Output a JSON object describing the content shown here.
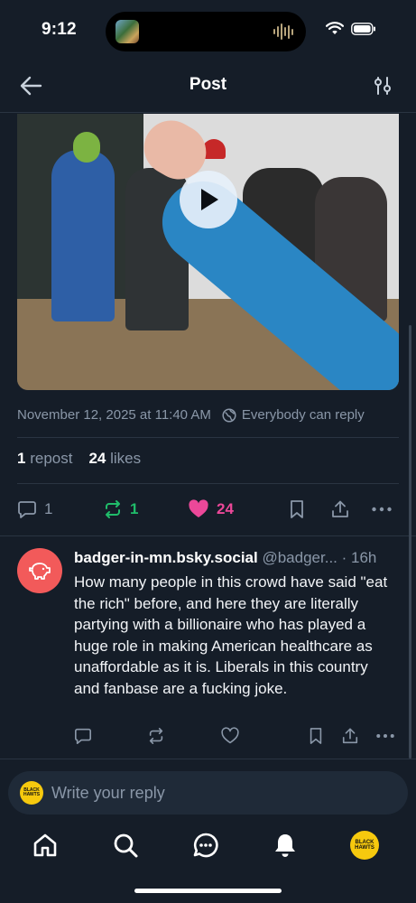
{
  "status": {
    "time": "9:12"
  },
  "header": {
    "title": "Post"
  },
  "post": {
    "date": "November 12, 2025 at 11:40 AM",
    "reply_setting": "Everybody can reply",
    "stats": {
      "reposts_count": "1",
      "reposts_label": "repost",
      "likes_count": "24",
      "likes_label": "likes"
    },
    "actions": {
      "reply_count": "1",
      "repost_count": "1",
      "like_count": "24"
    }
  },
  "reply": {
    "display_name": "badger-in-mn.bsky.social",
    "handle": "@badger...",
    "time": "· 16h",
    "text": "How many people in this crowd have said \"eat the rich\" before, and here they are literally partying with a billionaire who has played a huge role in making American healthcare as unaffordable as it is. Liberals in this country and fanbase are a fucking joke."
  },
  "composer": {
    "placeholder": "Write your reply"
  },
  "avatar_text": "BLACK HAWTS",
  "colors": {
    "background": "#151d28",
    "accent_green": "#20bc6a",
    "accent_pink": "#ec4899",
    "muted": "#8a97a8"
  },
  "icons": {
    "back": "arrow-left-icon",
    "filter": "sliders-icon",
    "play": "play-icon",
    "reply_setting": "globe-icon",
    "reply": "speech-bubble-icon",
    "repost": "repost-icon",
    "like": "heart-icon",
    "bookmark": "bookmark-icon",
    "share": "share-icon",
    "more": "ellipsis-icon",
    "nav": [
      "home-icon",
      "search-icon",
      "chat-icon",
      "bell-icon",
      "avatar"
    ]
  }
}
